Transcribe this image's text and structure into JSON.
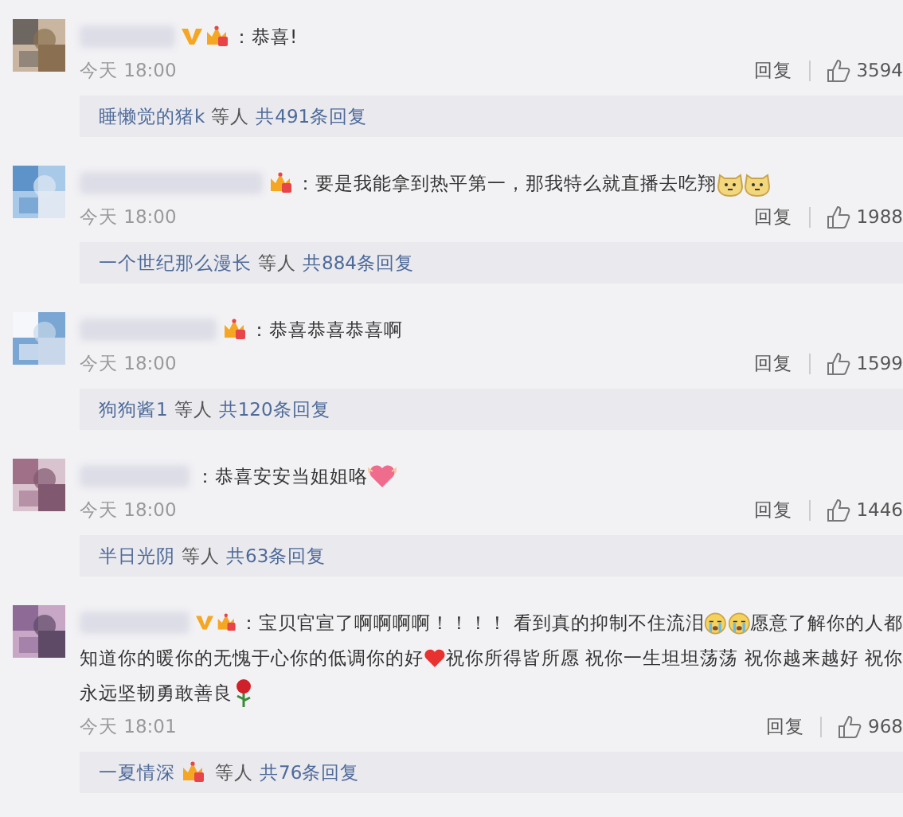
{
  "comments": [
    {
      "avatar": {
        "kind": "picture"
      },
      "verified": true,
      "fan_badge": true,
      "lines": [
        [
          {
            "kind": "text",
            "text": "：恭喜!"
          }
        ]
      ],
      "time": "今天 18:00",
      "reply_label": "回复",
      "likes": "3594",
      "summary": {
        "user": "睡懒觉的猪k",
        "user_badge": false,
        "others": "等人",
        "total": "共491条回复"
      }
    },
    {
      "avatar": {
        "kind": "picture"
      },
      "verified": false,
      "fan_badge": true,
      "lines": [
        [
          {
            "kind": "text",
            "text": "：要是我能拿到热平第一，那我特么就直播去吃翔"
          },
          {
            "kind": "doge"
          },
          {
            "kind": "doge"
          }
        ]
      ],
      "time": "今天 18:00",
      "reply_label": "回复",
      "likes": "1988",
      "summary": {
        "user": "一个世纪那么漫长",
        "user_badge": false,
        "others": "等人",
        "total": "共884条回复"
      }
    },
    {
      "avatar": {
        "kind": "picture"
      },
      "verified": false,
      "fan_badge": true,
      "lines": [
        [
          {
            "kind": "text",
            "text": "：恭喜恭喜恭喜啊"
          }
        ]
      ],
      "time": "今天 18:00",
      "reply_label": "回复",
      "likes": "1599",
      "summary": {
        "user": "狗狗酱1",
        "user_badge": false,
        "others": "等人",
        "total": "共120条回复"
      }
    },
    {
      "avatar": {
        "kind": "picture"
      },
      "verified": false,
      "fan_badge": false,
      "lines": [
        [
          {
            "kind": "text",
            "text": "：恭喜安安当姐姐咯"
          },
          {
            "kind": "pink-heart"
          }
        ]
      ],
      "time": "今天 18:00",
      "reply_label": "回复",
      "likes": "1446",
      "summary": {
        "user": "半日光阴",
        "user_badge": false,
        "others": "等人",
        "total": "共63条回复"
      }
    },
    {
      "avatar": {
        "kind": "picture"
      },
      "verified": true,
      "fan_badge": true,
      "lines": [
        [
          {
            "kind": "text",
            "text": "：宝贝官宣了啊啊啊啊！！！！ 看到真的抑制不住流泪"
          },
          {
            "kind": "crying"
          },
          {
            "kind": "crying"
          },
          {
            "kind": "text",
            "text": "愿意了解你的人都"
          }
        ],
        [
          {
            "kind": "text",
            "text": "知道你的暖你的无愧于心你的低调你的好"
          },
          {
            "kind": "heart"
          },
          {
            "kind": "text",
            "text": "祝你所得皆所愿 祝你一生坦坦荡荡 祝你越来越好 祝你"
          }
        ],
        [
          {
            "kind": "text",
            "text": "永远坚韧勇敢善良"
          },
          {
            "kind": "rose"
          }
        ]
      ],
      "time": "今天 18:01",
      "reply_label": "回复",
      "likes": "968",
      "summary": {
        "user": "一夏情深",
        "user_badge": true,
        "others": "等人",
        "total": "共76条回复"
      }
    }
  ]
}
